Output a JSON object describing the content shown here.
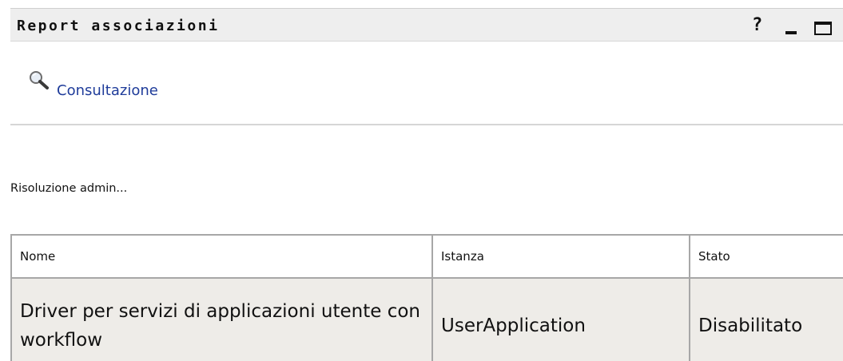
{
  "portlet": {
    "title": "Report associazioni",
    "controls": {
      "help": "?",
      "minimize_icon": "minimize-icon",
      "maximize_icon": "maximize-icon"
    }
  },
  "toolbar": {
    "lookup_label": "Consultazione",
    "lookup_icon": "magnifier-icon"
  },
  "status_text": "Risoluzione admin...",
  "table": {
    "headers": [
      "Nome",
      "Istanza",
      "Stato"
    ],
    "rows": [
      [
        "Driver per servizi di applicazioni utente con workflow",
        "UserApplication",
        "Disabilitato"
      ]
    ]
  },
  "colors": {
    "link": "#1f3c9a",
    "row_bg": "#eeece8",
    "title_bg": "#eeeeee",
    "border": "#a7a7a7"
  }
}
